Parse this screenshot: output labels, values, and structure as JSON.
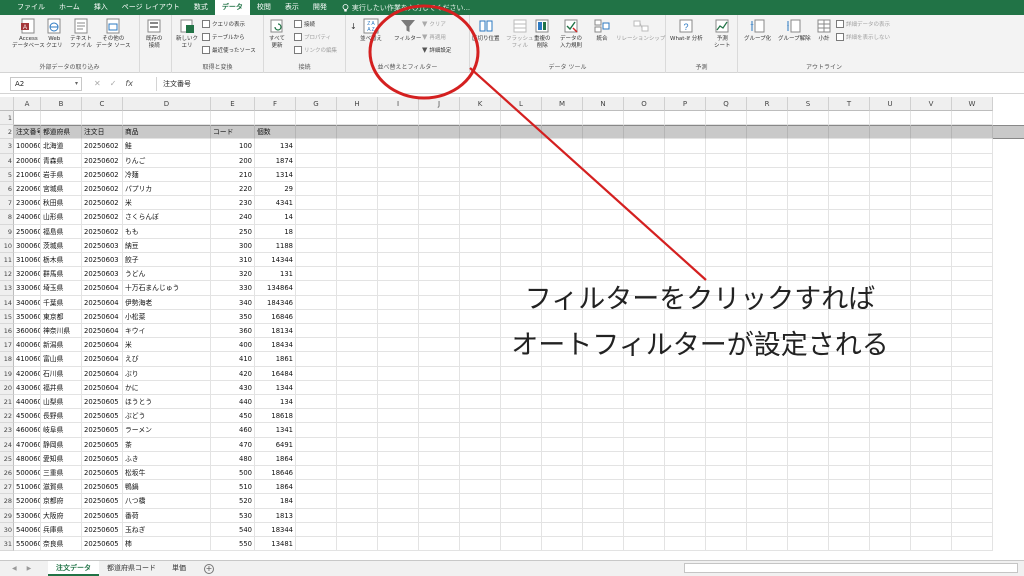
{
  "ribbon_tabs": [
    "ファイル",
    "ホーム",
    "挿入",
    "ページ レイアウト",
    "数式",
    "データ",
    "校閲",
    "表示",
    "開発"
  ],
  "active_tab": "データ",
  "tell_me": "実行したい作業を入力してください...",
  "ribbon": {
    "get_external": {
      "label": "外部データの取り込み",
      "buttons": [
        "Access\nデータベース",
        "Web\nクエリ",
        "テキスト\nファイル",
        "その他の\nデータ ソース",
        "既存の\n接続"
      ]
    },
    "get_transform": {
      "label": "取得と変換",
      "new_query": "新しいク\nエリ",
      "small": [
        "クエリの表示",
        "テーブルから",
        "最近使ったソース"
      ]
    },
    "connections": {
      "label": "接続",
      "refresh": "すべて\n更新",
      "small": [
        "接続",
        "プロパティ",
        "リンクの編集"
      ]
    },
    "sort_filter": {
      "label": "並べ替えとフィルター",
      "sort": "並べ替え",
      "filter": "フィルター",
      "small": [
        "クリア",
        "再適用",
        "詳細設定"
      ]
    },
    "data_tools": {
      "label": "データ ツール",
      "buttons": [
        "区切り位置",
        "フラッシュ\nフィル",
        "重複の\n削除",
        "データの\n入力規則",
        "統合",
        "リレーションシップ"
      ]
    },
    "forecast": {
      "label": "予測",
      "buttons": [
        "What-If 分析",
        "予測\nシート"
      ]
    },
    "outline": {
      "label": "アウトライン",
      "buttons": [
        "グループ化",
        "グループ解除",
        "小計"
      ],
      "small": [
        "詳細データの表示",
        "詳細を表示しない"
      ]
    }
  },
  "formula_bar": {
    "name_box": "A2",
    "fx": "fx",
    "content": "注文番号"
  },
  "columns": [
    "A",
    "B",
    "C",
    "D",
    "E",
    "F",
    "G",
    "H",
    "I",
    "J",
    "K",
    "L",
    "M",
    "N",
    "O",
    "P",
    "Q",
    "R",
    "S",
    "T",
    "U",
    "V",
    "W"
  ],
  "header_row": [
    "注文番号",
    "都道府県",
    "注文日",
    "商品",
    "コード",
    "個数"
  ],
  "rows": [
    [
      "10006001",
      "北海道",
      "20250602",
      "鮭",
      "100",
      "134"
    ],
    [
      "20006001",
      "青森県",
      "20250602",
      "りんご",
      "200",
      "1874"
    ],
    [
      "21006001",
      "岩手県",
      "20250602",
      "冷麺",
      "210",
      "1314"
    ],
    [
      "22006001",
      "宮城県",
      "20250602",
      "パプリカ",
      "220",
      "29"
    ],
    [
      "23006001",
      "秋田県",
      "20250602",
      "米",
      "230",
      "4341"
    ],
    [
      "24006001",
      "山形県",
      "20250602",
      "さくらんぼ",
      "240",
      "14"
    ],
    [
      "25006001",
      "福島県",
      "20250602",
      "もも",
      "250",
      "18"
    ],
    [
      "30006001",
      "茨城県",
      "20250603",
      "納豆",
      "300",
      "1188"
    ],
    [
      "31006001",
      "栃木県",
      "20250603",
      "餃子",
      "310",
      "14344"
    ],
    [
      "32006001",
      "群馬県",
      "20250603",
      "うどん",
      "320",
      "131"
    ],
    [
      "33006001",
      "埼玉県",
      "20250604",
      "十万石まんじゅう",
      "330",
      "134864"
    ],
    [
      "34006001",
      "千葉県",
      "20250604",
      "伊勢海老",
      "340",
      "184346"
    ],
    [
      "35006001",
      "東京都",
      "20250604",
      "小松菜",
      "350",
      "16846"
    ],
    [
      "36006001",
      "神奈川県",
      "20250604",
      "キウイ",
      "360",
      "18134"
    ],
    [
      "40006001",
      "新潟県",
      "20250604",
      "米",
      "400",
      "18434"
    ],
    [
      "41006001",
      "富山県",
      "20250604",
      "えび",
      "410",
      "1861"
    ],
    [
      "42006001",
      "石川県",
      "20250604",
      "ぶり",
      "420",
      "16484"
    ],
    [
      "43006001",
      "福井県",
      "20250604",
      "かに",
      "430",
      "1344"
    ],
    [
      "44006001",
      "山梨県",
      "20250605",
      "ほうとう",
      "440",
      "134"
    ],
    [
      "45006001",
      "長野県",
      "20250605",
      "ぶどう",
      "450",
      "18618"
    ],
    [
      "46006001",
      "岐阜県",
      "20250605",
      "ラーメン",
      "460",
      "1341"
    ],
    [
      "47006001",
      "静岡県",
      "20250605",
      "茶",
      "470",
      "6491"
    ],
    [
      "48006001",
      "愛知県",
      "20250605",
      "ふき",
      "480",
      "1864"
    ],
    [
      "50006001",
      "三重県",
      "20250605",
      "松坂牛",
      "500",
      "18646"
    ],
    [
      "51006001",
      "滋賀県",
      "20250605",
      "鴨鍋",
      "510",
      "1864"
    ],
    [
      "52006001",
      "京都府",
      "20250605",
      "八つ橋",
      "520",
      "184"
    ],
    [
      "53006001",
      "大阪府",
      "20250605",
      "番荷",
      "530",
      "1813"
    ],
    [
      "54006001",
      "兵庫県",
      "20250605",
      "玉ねぎ",
      "540",
      "18344"
    ],
    [
      "55006001",
      "奈良県",
      "20250605",
      "柿",
      "550",
      "13481"
    ]
  ],
  "sheet_tabs": [
    "注文データ",
    "都道府県コード",
    "単価"
  ],
  "active_sheet": "注文データ",
  "annotation": {
    "line1": "フィルターをクリックすれば",
    "line2": "オートフィルターが設定される"
  },
  "colors": {
    "excel_green": "#217346",
    "annotation_red": "#d42020",
    "header_fill": "#c9c9c9"
  }
}
